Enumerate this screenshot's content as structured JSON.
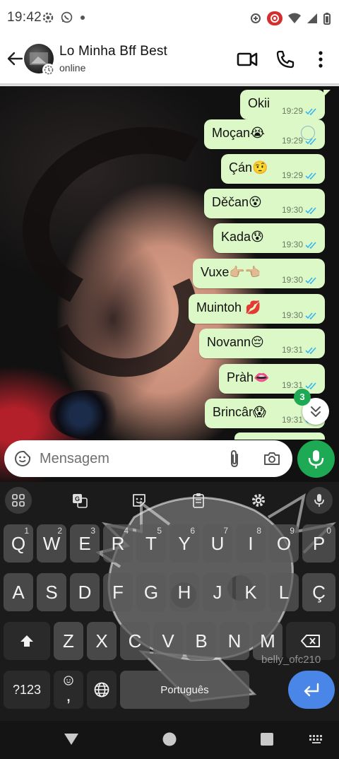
{
  "status_bar": {
    "time": "19:42"
  },
  "header": {
    "contact_name": "Lo Minha Bff Best",
    "status": "online"
  },
  "messages": [
    {
      "text": "Okii",
      "time": "19:29"
    },
    {
      "text": "Moçan😭",
      "time": "19:29"
    },
    {
      "text": "Çán🤨",
      "time": "19:29"
    },
    {
      "text": "Děčan😵",
      "time": "19:30"
    },
    {
      "text": "Kada😰",
      "time": "19:30"
    },
    {
      "text": "Vuxe👉🏼👈🏼",
      "time": "19:30"
    },
    {
      "text": "Muintoh 💋",
      "time": "19:30"
    },
    {
      "text": "Novann😔",
      "time": "19:31"
    },
    {
      "text": "Pràh👄",
      "time": "19:31"
    },
    {
      "text": "Brincâr😱",
      "time": "19:31"
    }
  ],
  "unread_count": "3",
  "composer": {
    "placeholder": "Mensagem"
  },
  "keyboard": {
    "row1": [
      {
        "label": "Q",
        "hint": "1"
      },
      {
        "label": "W",
        "hint": "2"
      },
      {
        "label": "E",
        "hint": "3"
      },
      {
        "label": "R",
        "hint": "4"
      },
      {
        "label": "T",
        "hint": "5"
      },
      {
        "label": "Y",
        "hint": "6"
      },
      {
        "label": "U",
        "hint": "7"
      },
      {
        "label": "I",
        "hint": "8"
      },
      {
        "label": "O",
        "hint": "9"
      },
      {
        "label": "P",
        "hint": "0"
      }
    ],
    "row2": [
      "A",
      "S",
      "D",
      "F",
      "G",
      "H",
      "J",
      "K",
      "L",
      "Ç"
    ],
    "row3": [
      "Z",
      "X",
      "C",
      "V",
      "B",
      "N",
      "M"
    ],
    "symbols_label": "?123",
    "comma_label": ",",
    "space_label": "Português",
    "watermark": "belly_ofc210"
  },
  "colors": {
    "bubble": "#dcf8c6",
    "accent_green": "#1ea954",
    "tick_blue": "#34b7f1",
    "enter_blue": "#4a86e8"
  }
}
